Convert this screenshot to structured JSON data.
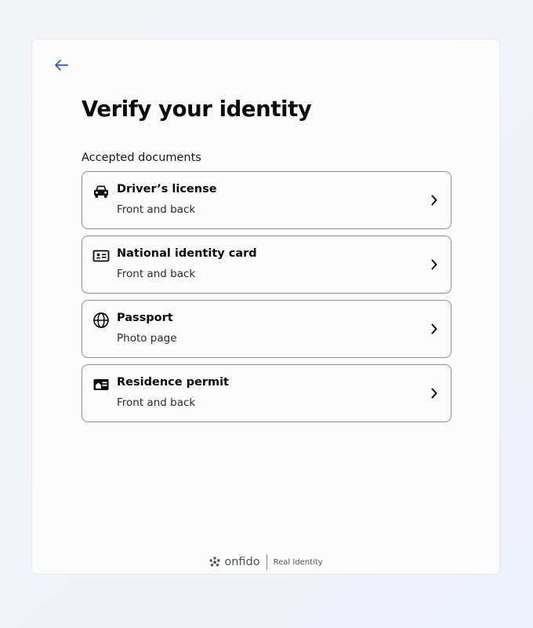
{
  "header": {
    "back_icon": "arrow-left-icon",
    "title": "Verify your identity"
  },
  "documents": {
    "section_label": "Accepted documents",
    "items": [
      {
        "icon": "car-icon",
        "name": "Driver’s license",
        "detail": "Front and back"
      },
      {
        "icon": "id-card-icon",
        "name": "National identity card",
        "detail": "Front and back"
      },
      {
        "icon": "globe-icon",
        "name": "Passport",
        "detail": "Photo page"
      },
      {
        "icon": "residence-card-icon",
        "name": "Residence permit",
        "detail": "Front and back"
      }
    ]
  },
  "footer": {
    "logo_text": "onfido",
    "tagline": "Real Identity"
  },
  "colors": {
    "accent": "#1f5fd0",
    "text": "#0b0b0d",
    "border": "#8d8f9a"
  }
}
